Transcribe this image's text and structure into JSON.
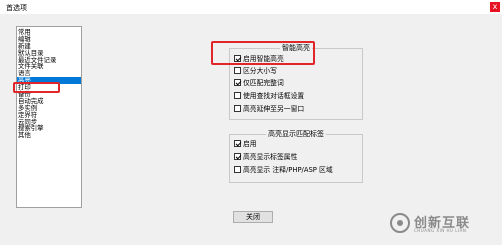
{
  "window": {
    "title": "首选项",
    "close_glyph": "x"
  },
  "categories": [
    {
      "label": "常用",
      "selected": false
    },
    {
      "label": "编辑",
      "selected": false
    },
    {
      "label": "新建",
      "selected": false
    },
    {
      "label": "默认目录",
      "selected": false
    },
    {
      "label": "最近文件记录",
      "selected": false
    },
    {
      "label": "文件关联",
      "selected": false
    },
    {
      "label": "语言",
      "selected": false
    },
    {
      "label": "高亮",
      "selected": true
    },
    {
      "label": "打印",
      "selected": false
    },
    {
      "label": "备份",
      "selected": false
    },
    {
      "label": "自动完成",
      "selected": false
    },
    {
      "label": "多实例",
      "selected": false
    },
    {
      "label": "定界符",
      "selected": false
    },
    {
      "label": "云同步",
      "selected": false
    },
    {
      "label": "搜索引擎",
      "selected": false
    },
    {
      "label": "其他",
      "selected": false
    }
  ],
  "smart_highlight": {
    "legend": "智能高亮",
    "options": [
      {
        "label": "启用智能高亮",
        "checked": true
      },
      {
        "label": "区分大小写",
        "checked": false
      },
      {
        "label": "仅匹配完整词",
        "checked": true
      },
      {
        "label": "使用查找对话框设置",
        "checked": false
      },
      {
        "label": "高亮延伸至另一窗口",
        "checked": false
      }
    ]
  },
  "tag_highlight": {
    "legend": "高亮显示匹配标签",
    "options": [
      {
        "label": "启用",
        "checked": true
      },
      {
        "label": "高亮显示标签属性",
        "checked": true
      },
      {
        "label": "高亮显示 注释/PHP/ASP 区域",
        "checked": false
      }
    ]
  },
  "buttons": {
    "close": "关闭"
  },
  "watermark": {
    "text": "创新互联",
    "sub": "CHUANG XIN HU LIAN"
  },
  "colors": {
    "selection": "#0078d7",
    "highlight_box": "#e0262b",
    "close": "#e81123"
  }
}
